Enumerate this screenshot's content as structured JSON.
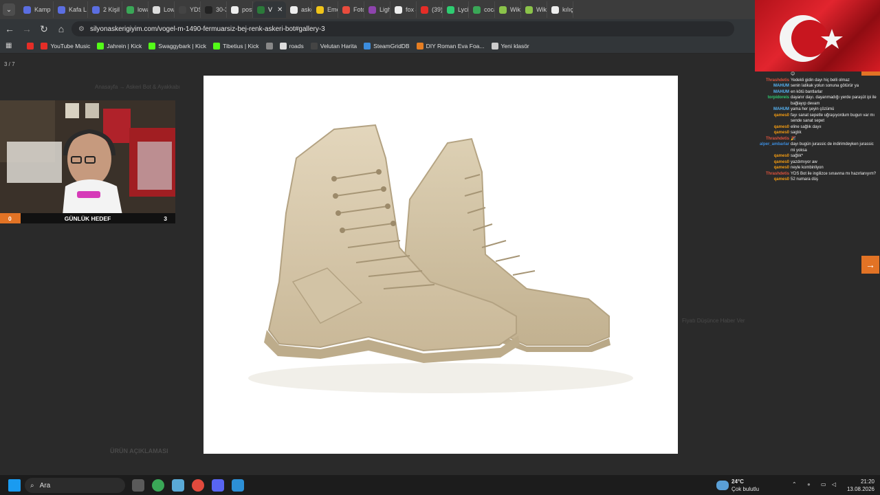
{
  "tabs": [
    {
      "label": "Kamp",
      "color": "#5b6ee1"
    },
    {
      "label": "Kafa L",
      "color": "#5b6ee1"
    },
    {
      "label": "2 Kişil",
      "color": "#5b6ee1"
    },
    {
      "label": "lowa",
      "color": "#3aa757"
    },
    {
      "label": "Lowa",
      "color": "#dddddd"
    },
    {
      "label": "YDS A",
      "color": "#444444"
    },
    {
      "label": "30-32",
      "color": "#222222"
    },
    {
      "label": "postal",
      "color": "#eeeeee"
    },
    {
      "label": "V",
      "color": "#2b7a3a",
      "active": true
    },
    {
      "label": "askeri",
      "color": "#eeeeee"
    },
    {
      "label": "Emeri",
      "color": "#f0c419"
    },
    {
      "label": "Fotoğ",
      "color": "#e94c3d"
    },
    {
      "label": "LightS",
      "color": "#8e44ad"
    },
    {
      "label": "fox 46",
      "color": "#eeeeee"
    },
    {
      "label": "(39) L",
      "color": "#e52d27"
    },
    {
      "label": "Lycian",
      "color": "#2ecc71"
    },
    {
      "label": "coca c",
      "color": "#3aa757"
    },
    {
      "label": "Wikile",
      "color": "#8bc34a"
    },
    {
      "label": "Wikile",
      "color": "#8bc34a"
    },
    {
      "label": "kılıçda",
      "color": "#eeeeee"
    }
  ],
  "toolbar": {
    "url": "silyonaskerigiyim.com/vogel-m-1490-fermuarsiz-bej-renk-askeri-bot#gallery-3"
  },
  "bookmarks": [
    {
      "label": "",
      "color": "#e52d27"
    },
    {
      "label": "YouTube Music",
      "color": "#e52d27"
    },
    {
      "label": "Jahrein | Kick",
      "color": "#53fc18"
    },
    {
      "label": "Swaggybark | Kick",
      "color": "#53fc18"
    },
    {
      "label": "Tibetius | Kick",
      "color": "#53fc18"
    },
    {
      "label": "",
      "color": "#888888"
    },
    {
      "label": "roads",
      "color": "#dddddd"
    },
    {
      "label": "Velutan Harita",
      "color": "#444444"
    },
    {
      "label": "SteamGridDB",
      "color": "#3c8dde"
    },
    {
      "label": "DIY Roman Eva Foa...",
      "color": "#e67e22"
    },
    {
      "label": "Yeni klasör",
      "color": "#cccccc"
    }
  ],
  "gallery": {
    "counter": "3 / 7"
  },
  "page_bg": {
    "breadcrumb": "Anasayfa  →  Askeri Bot & Ayakkabı",
    "description_tab": "ÜRÜN AÇIKLAMASI",
    "price_note": "Fiyatı Düşünce Haber Ver"
  },
  "chat": [
    {
      "name": "",
      "color": "#e0533d",
      "msg": "😊"
    },
    {
      "name": "Thrashdetis",
      "color": "#e0533d",
      "msg": "Yedekli gidin dayı hiç belli olmaz"
    },
    {
      "name": "MAHUM",
      "color": "#56b4f5",
      "msg": "senin latikak yolun sonuna götürür ya"
    },
    {
      "name": "MAHUM",
      "color": "#56b4f5",
      "msg": "en kötü bantlarlar"
    },
    {
      "name": "torpidoreis",
      "color": "#2ecc71",
      "msg": "dayanır dayı. dayanmadığı yerde paraşüt ipi ile bağlayıp devam"
    },
    {
      "name": "MAHUM",
      "color": "#56b4f5",
      "msg": "yama her şeyin çözümü"
    },
    {
      "name": "qames0",
      "color": "#f39c12",
      "msg": "fayı sanat sepetle uğraşıyordum bugun var mı sende sanat sepet"
    },
    {
      "name": "qames0",
      "color": "#f39c12",
      "msg": "eline sağlık dayıı"
    },
    {
      "name": "qames0",
      "color": "#f39c12",
      "msg": "saglık"
    },
    {
      "name": "Thrashdetis",
      "color": "#e0533d",
      "msg": "🎉"
    },
    {
      "name": "alper_ambarlar",
      "color": "#3c8dde",
      "msg": "dayı bugün jurassic de indirimdeyken jurassic mi yoksa"
    },
    {
      "name": "qames0",
      "color": "#f39c12",
      "msg": "sağlık*"
    },
    {
      "name": "qames0",
      "color": "#f39c12",
      "msg": "yazdımıyor aw"
    },
    {
      "name": "qames0",
      "color": "#f39c12",
      "msg": "neyle kombinliyon"
    },
    {
      "name": "Thrashdetis",
      "color": "#e0533d",
      "msg": "YDS Bot ile ingilizce sınavına mı hazırlanıyım?"
    },
    {
      "name": "qames0",
      "color": "#f39c12",
      "msg": "52 numara düş"
    }
  ],
  "webcam": {
    "left_count": "0",
    "label": "GÜNLÜK HEDEF",
    "right_count": "3"
  },
  "taskbar": {
    "search_placeholder": "Ara",
    "weather_temp": "24°C",
    "weather_desc": "Çok bulutlu",
    "time": "21:20",
    "date": "13.08.2026"
  }
}
